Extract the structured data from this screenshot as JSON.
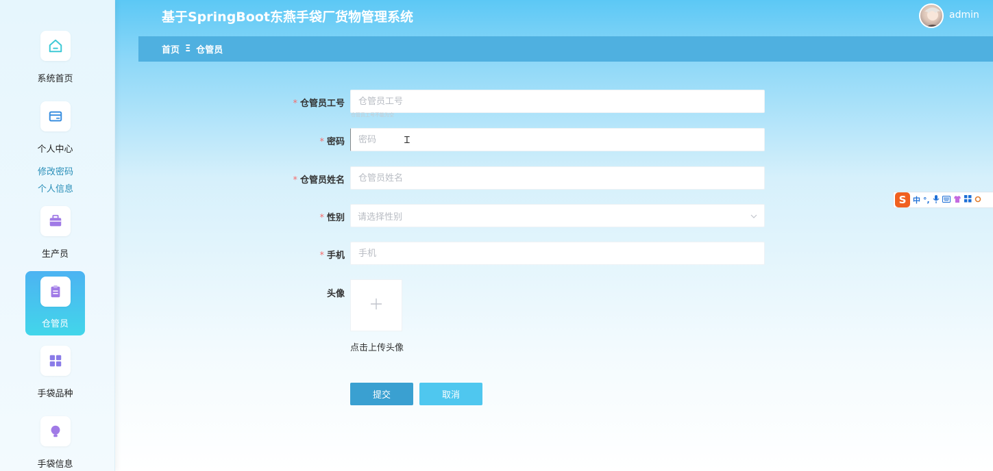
{
  "header": {
    "title": "基于SpringBoot东燕手袋厂货物管理系统",
    "username": "admin"
  },
  "breadcrumb": {
    "home": "首页",
    "separator": "Ξ",
    "current": "仓管员"
  },
  "sidebar": {
    "items": [
      {
        "label": "系统首页",
        "icon": "home-icon"
      },
      {
        "label": "个人中心",
        "icon": "wallet-icon"
      },
      {
        "label": "生产员",
        "icon": "briefcase-icon"
      },
      {
        "label": "仓管员",
        "icon": "clipboard-icon",
        "active": true
      },
      {
        "label": "手袋品种",
        "icon": "grid-icon"
      },
      {
        "label": "手袋信息",
        "icon": "lightbulb-icon"
      }
    ],
    "submenu": [
      "修改密码",
      "个人信息"
    ]
  },
  "form": {
    "fields": {
      "work_id": {
        "label": "仓管员工号",
        "placeholder": "仓管员工号",
        "required": true,
        "hint": "仓管员工号不能为空"
      },
      "password": {
        "label": "密码",
        "placeholder": "密码",
        "required": true
      },
      "name": {
        "label": "仓管员姓名",
        "placeholder": "仓管员姓名",
        "required": true
      },
      "gender": {
        "label": "性别",
        "placeholder": "请选择性别",
        "required": true
      },
      "phone": {
        "label": "手机",
        "placeholder": "手机",
        "required": true
      },
      "avatar": {
        "label": "头像",
        "caption": "点击上传头像"
      }
    },
    "required_mark": "*",
    "submit_label": "提交",
    "cancel_label": "取消"
  },
  "ime_toolbar": {
    "logo": "S",
    "mode": "中",
    "punct": "°,"
  },
  "colors": {
    "accent": "#4fb0e0",
    "submit": "#3aa0d1",
    "cancel": "#4fc7ef",
    "required": "#f56c6c"
  }
}
